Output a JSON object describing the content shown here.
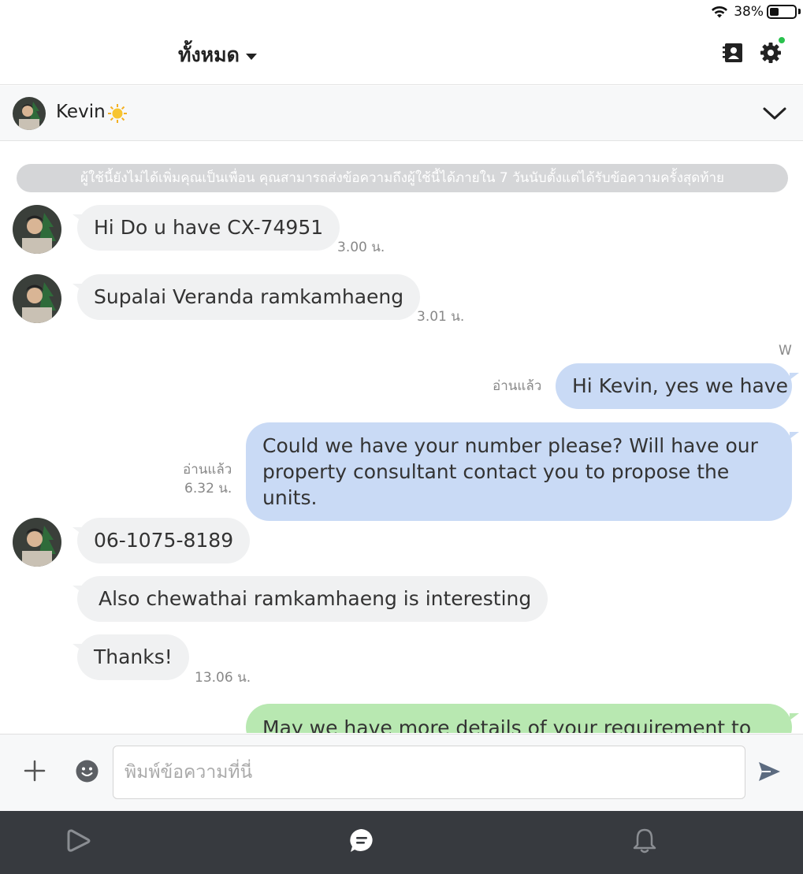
{
  "status_bar": {
    "battery_text": "38%",
    "battery_level": 0.38
  },
  "header": {
    "title": "ทั้งหมด"
  },
  "contact": {
    "name": "Kevin"
  },
  "chat": {
    "notice": "ผู้ใช้นี้ยังไม่ได้เพิ่มคุณเป็นเพื่อน คุณสามารถส่งข้อความถึงผู้ใช้นี้ได้ภายใน 7 วันนับตั้งแต่ได้รับข้อความครั้งสุดท้าย",
    "messages": [
      {
        "text": "Hi Do u have CX-74951",
        "time": "3.00 น."
      },
      {
        "text": "Supalai Veranda ramkamhaeng",
        "time": "3.01 น."
      },
      {
        "sender": "W",
        "text": "Hi Kevin, yes we have",
        "read": "อ่านแล้ว"
      },
      {
        "text_line1": "Could we have your number please? Will have our",
        "text_line2": "property consultant contact you to propose the units.",
        "read": "อ่านแล้ว",
        "time": "6.32 น."
      },
      {
        "text": "06-1075-8189"
      },
      {
        "text": "Also chewathai ramkamhaeng is interesting"
      },
      {
        "text": "Thanks!",
        "time": "13.06 น."
      },
      {
        "text": "May we have more details of your requirement to"
      }
    ]
  },
  "input": {
    "placeholder": "พิมพ์ข้อความที่นี่"
  },
  "colors": {
    "outgoing_bubble": "#c9daf5",
    "incoming_bubble": "#f0f1f2",
    "green_bubble": "#b8e8b1",
    "nav_bg": "#373a3f",
    "online_dot": "#2ac14e"
  }
}
